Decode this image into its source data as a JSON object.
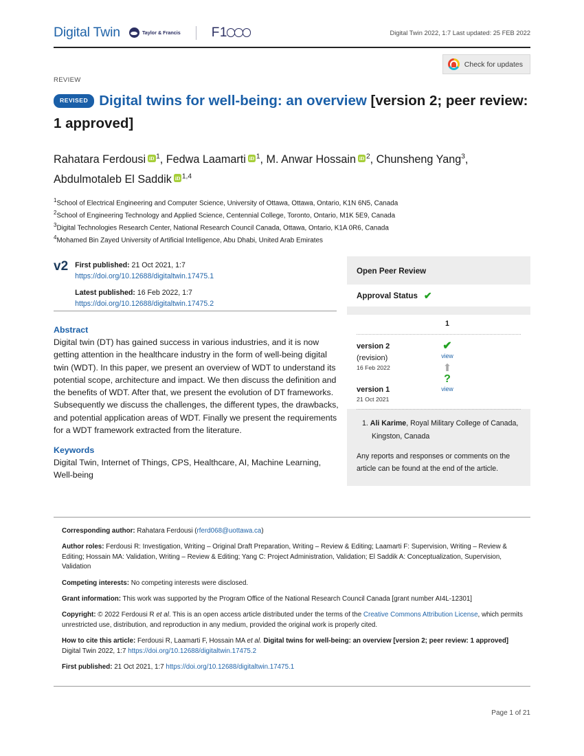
{
  "header": {
    "journal": "Digital Twin",
    "publisher_logo_text": "Taylor & Francis",
    "platform_logo_text": "F1000",
    "citation_line": "Digital Twin 2022, 1:7 Last updated: 25 FEB 2022",
    "crossmark_label": "Check for updates"
  },
  "article": {
    "type": "REVIEW",
    "status_badge": "REVISED",
    "title_main": "Digital twins for well-being: an overview",
    "title_version": "[version 2; peer review: 1 approved]",
    "authors": [
      {
        "name": "Rahatara Ferdousi",
        "orcid": true,
        "sup": "1",
        "sep": ", "
      },
      {
        "name": "Fedwa Laamarti",
        "orcid": true,
        "sup": "1",
        "sep": ", "
      },
      {
        "name": "M. Anwar Hossain",
        "orcid": true,
        "sup": "2",
        "sep": ", "
      },
      {
        "name": "Chunsheng Yang",
        "orcid": false,
        "sup": "3",
        "sep": ", "
      },
      {
        "name": "Abdulmotaleb El Saddik",
        "orcid": true,
        "sup": "1,4",
        "sep": ""
      }
    ],
    "affiliations": [
      {
        "num": "1",
        "text": "School of Electrical Engineering and Computer Science, University of Ottawa, Ottawa, Ontario, K1N 6N5, Canada"
      },
      {
        "num": "2",
        "text": "School of Engineering Technology and Applied Science, Centennial College, Toronto, Ontario, M1K 5E9, Canada"
      },
      {
        "num": "3",
        "text": "Digital Technologies Research Center, National Research Council Canada, Ottawa, Ontario, K1A 0R6, Canada"
      },
      {
        "num": "4",
        "text": "Mohamed Bin Zayed University of Artificial Intelligence, Abu Dhabi, United Arab Emirates"
      }
    ]
  },
  "publication": {
    "version_tag": "v2",
    "first_published_label": "First published:",
    "first_published_value": "21 Oct 2021, 1:7",
    "first_published_doi": "https://doi.org/10.12688/digitaltwin.17475.1",
    "latest_published_label": "Latest published:",
    "latest_published_value": "16 Feb 2022, 1:7",
    "latest_published_doi": "https://doi.org/10.12688/digitaltwin.17475.2"
  },
  "abstract": {
    "heading": "Abstract",
    "text": "Digital twin (DT) has gained success in various industries, and it is now getting attention in the healthcare industry in the form of well-being digital twin (WDT). In this paper, we present an overview of WDT to understand its potential scope, architecture and impact. We then discuss the definition  and the benefits of WDT. After that, we present the evolution of DT frameworks. Subsequently we discuss the challenges, the different types, the drawbacks, and potential application areas of WDT. Finally we present the requirements for a WDT framework extracted from the literature."
  },
  "keywords": {
    "heading": "Keywords",
    "text": "Digital Twin, Internet of Things, CPS, Healthcare, AI, Machine Learning, Well-being"
  },
  "peer_review": {
    "panel_title": "Open Peer Review",
    "approval_label": "Approval Status",
    "approval_icon": "green-check",
    "reviewer_column_header": "1",
    "versions": [
      {
        "name": "version 2",
        "qualifier": "(revision)",
        "date": "16 Feb 2022",
        "status_icon": "green-check",
        "view_label": "view"
      },
      {
        "name": "version 1",
        "qualifier": "",
        "date": "21 Oct 2021",
        "status_icon": "green-question",
        "view_label": "view"
      }
    ],
    "reviewer_number": "1.",
    "reviewer_name": "Ali Karime",
    "reviewer_affiliation": ", Royal Military College of Canada, Kingston, Canada",
    "note": "Any reports and responses or comments on the article can be found at the end of the article."
  },
  "metadata": {
    "corresponding_label": "Corresponding author:",
    "corresponding_name": "Rahatara Ferdousi (",
    "corresponding_email": "rferd068@uottawa.ca",
    "corresponding_close": ")",
    "author_roles_label": "Author roles:",
    "author_roles_text": " Ferdousi R: Investigation, Writing – Original Draft Preparation, Writing – Review & Editing; Laamarti F: Supervision, Writing – Review & Editing; Hossain MA: Validation, Writing – Review & Editing; Yang C: Project Administration, Validation; El Saddik A: Conceptualization, Supervision, Validation",
    "competing_label": "Competing interests:",
    "competing_text": " No competing interests were disclosed.",
    "grant_label": "Grant information:",
    "grant_text": " This work was supported by the Program Office of the National Research Council Canada [grant number AI4L-12301]",
    "copyright_label": "Copyright:",
    "copyright_text_1": " © 2022 Ferdousi R ",
    "copyright_etal": "et al",
    "copyright_text_2": ". This is an open access article distributed under the terms of the ",
    "copyright_link": "Creative Commons Attribution License",
    "copyright_text_3": ", which permits unrestricted use, distribution, and reproduction in any medium, provided the original work is properly cited.",
    "cite_label": "How to cite this article:",
    "cite_text_1": " Ferdousi R, Laamarti F, Hossain MA ",
    "cite_etal": "et al.",
    "cite_title": " Digital twins for well-being: an overview [version 2; peer review: 1 approved]",
    "cite_text_2": " Digital Twin 2022, 1:7 ",
    "cite_doi": "https://doi.org/10.12688/digitaltwin.17475.2",
    "firstpub_label": "First published:",
    "firstpub_text": " 21 Oct 2021, 1:7 ",
    "firstpub_doi": "https://doi.org/10.12688/digitaltwin.17475.1"
  },
  "footer": {
    "page_number": "Page 1 of 21"
  }
}
